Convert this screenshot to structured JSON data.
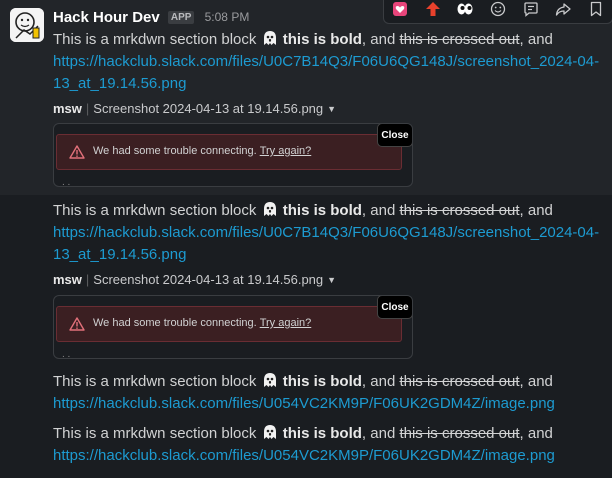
{
  "toolbar": {
    "icons": [
      "heart-reaction-icon",
      "arrow-up-reaction-icon",
      "eyes-reaction-icon",
      "add-reaction-icon",
      "reply-in-thread-icon",
      "share-icon",
      "bookmark-icon"
    ]
  },
  "message": {
    "sender": "Hack Hour Dev",
    "badge": "APP",
    "time": "5:08 PM"
  },
  "blocks": [
    {
      "text_before": "This is a mrkdwn section block",
      "bold": "this is bold",
      "text_mid": ", and",
      "strike": "this is crossed out",
      "text_after": ", and",
      "link_line1": "https://hackclub.slack.com/files/U0C7B14Q3/F06U6QG148J/screenshot_2024-04-",
      "link_line2": "13_at_19.14.56.png",
      "file_owner": "msw",
      "file_name": "Screenshot 2024-04-13 at 19.14.56.png",
      "error_text": "We had some trouble connecting.",
      "error_link": "Try again?",
      "close_label": "Close"
    },
    {
      "text_before": "This is a mrkdwn section block",
      "bold": "this is bold",
      "text_mid": ", and",
      "strike": "this is crossed out",
      "text_after": ", and",
      "link_line1": "https://hackclub.slack.com/files/U0C7B14Q3/F06U6QG148J/screenshot_2024-04-",
      "link_line2": "13_at_19.14.56.png",
      "file_owner": "msw",
      "file_name": "Screenshot 2024-04-13 at 19.14.56.png",
      "error_text": "We had some trouble connecting.",
      "error_link": "Try again?",
      "close_label": "Close"
    },
    {
      "text_before": "This is a mrkdwn section block",
      "bold": "this is bold",
      "text_mid": ", and",
      "strike": "this is crossed out",
      "text_after": ", and",
      "link_line1": "https://hackclub.slack.com/files/U054VC2KM9P/F06UK2GDM4Z/image.png"
    },
    {
      "text_before": "This is a mrkdwn section block",
      "bold": "this is bold",
      "text_mid": ", and",
      "strike": "this is crossed out",
      "text_after": ", and",
      "link_line1": "https://hackclub.slack.com/files/U054VC2KM9P/F06UK2GDM4Z/image.png"
    }
  ],
  "colors": {
    "background": "#1a1d21",
    "hover_background": "#222529",
    "link": "#1d9bd1",
    "error_bg": "#3b1f22"
  }
}
